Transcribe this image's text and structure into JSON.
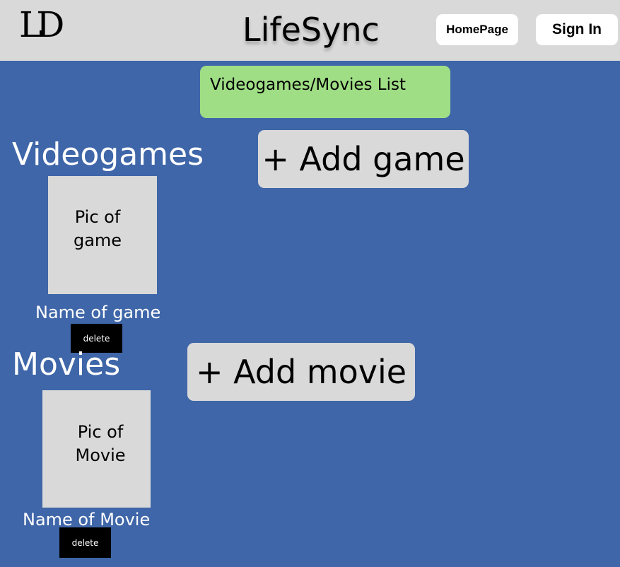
{
  "header": {
    "logo_text": "LD",
    "app_title": "LifeSync",
    "homepage_label": "HomePage",
    "signin_label": "Sign In"
  },
  "list_title": "Videogames/Movies List",
  "videogames": {
    "heading": "Videogames",
    "add_label": "+ Add game",
    "items": [
      {
        "pic_line1": "Pic of",
        "pic_line2": "game",
        "name": "Name of game",
        "delete_label": "delete"
      }
    ]
  },
  "movies": {
    "heading": "Movies",
    "add_label": "+ Add movie",
    "items": [
      {
        "pic_line1": "Pic of",
        "pic_line2": "Movie",
        "name": "Name of Movie",
        "delete_label": "delete"
      }
    ]
  },
  "colors": {
    "background": "#3f66a8",
    "header": "#d9d9d9",
    "list_title_box": "#9fde85",
    "placeholder": "#d9d9d9",
    "delete_button": "#000000"
  }
}
